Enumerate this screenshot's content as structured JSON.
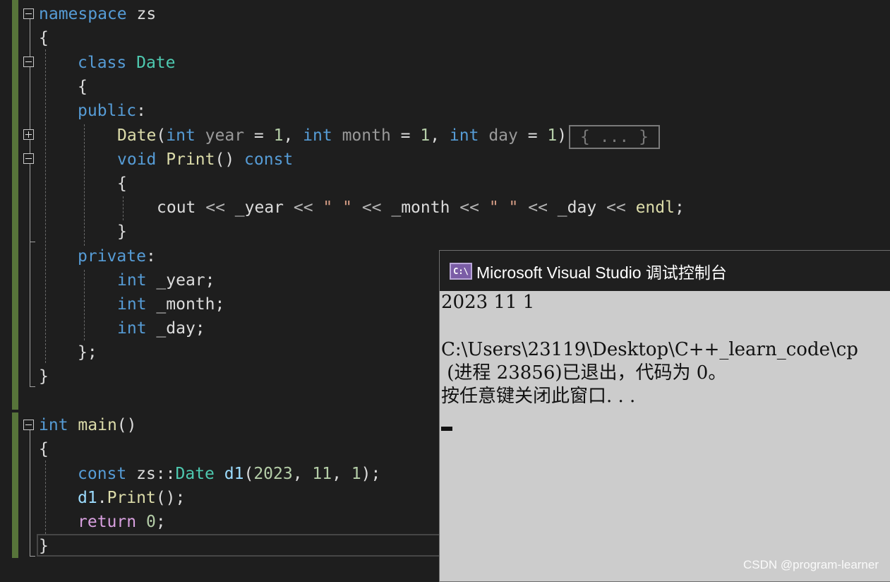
{
  "editor": {
    "collapsed_label": "{ ... }",
    "lines": {
      "l1": [
        "namespace",
        " zs"
      ],
      "l2": "{",
      "l3": [
        "class",
        " ",
        "Date"
      ],
      "l4": "{",
      "l5": [
        "public",
        ":"
      ],
      "l6": [
        "Date",
        "(",
        "int",
        " ",
        "year",
        " = ",
        "1",
        ", ",
        "int",
        " ",
        "month",
        " = ",
        "1",
        ", ",
        "int",
        " ",
        "day",
        " = ",
        "1",
        ")"
      ],
      "l7": [
        "void",
        " ",
        "Print",
        "() ",
        "const"
      ],
      "l8": "{",
      "l9": [
        "cout",
        " << ",
        "_year",
        " << ",
        "\" \"",
        " << ",
        "_month",
        " << ",
        "\" \"",
        " << ",
        "_day",
        " << ",
        "endl",
        ";"
      ],
      "l10": "}",
      "l11": [
        "private",
        ":"
      ],
      "l12": [
        "int",
        " ",
        "_year",
        ";"
      ],
      "l13": [
        "int",
        " ",
        "_month",
        ";"
      ],
      "l14": [
        "int",
        " ",
        "_day",
        ";"
      ],
      "l15": "};",
      "l16": "}",
      "l17": [
        "int",
        " ",
        "main",
        "()"
      ],
      "l18": "{",
      "l19": [
        "const",
        " zs::",
        "Date",
        " ",
        "d1",
        "(",
        "2023",
        ", ",
        "11",
        ", ",
        "1",
        ");"
      ],
      "l20": [
        "d1",
        ".",
        "Print",
        "();"
      ],
      "l21": [
        "return",
        " ",
        "0",
        ";"
      ],
      "l22": "}"
    }
  },
  "console": {
    "title": "Microsoft Visual Studio 调试控制台",
    "icon_label": "C:\\",
    "output": [
      "2023 11 1",
      "",
      "C:\\Users\\23119\\Desktop\\C++_learn_code\\cp",
      " (进程 23856)已退出，代码为 0。",
      "按任意键关闭此窗口. . ."
    ]
  },
  "watermark": "CSDN @program-learner",
  "colors": {
    "background": "#1e1e1e",
    "keyword": "#569cd6",
    "type": "#4ec9b0",
    "function": "#dcdcaa",
    "number": "#b5cea8",
    "string": "#d69d85",
    "variable": "#9cdcfe",
    "control": "#d8a0df",
    "console_bg": "#cccccc",
    "gutter_marker": "#57743a"
  }
}
